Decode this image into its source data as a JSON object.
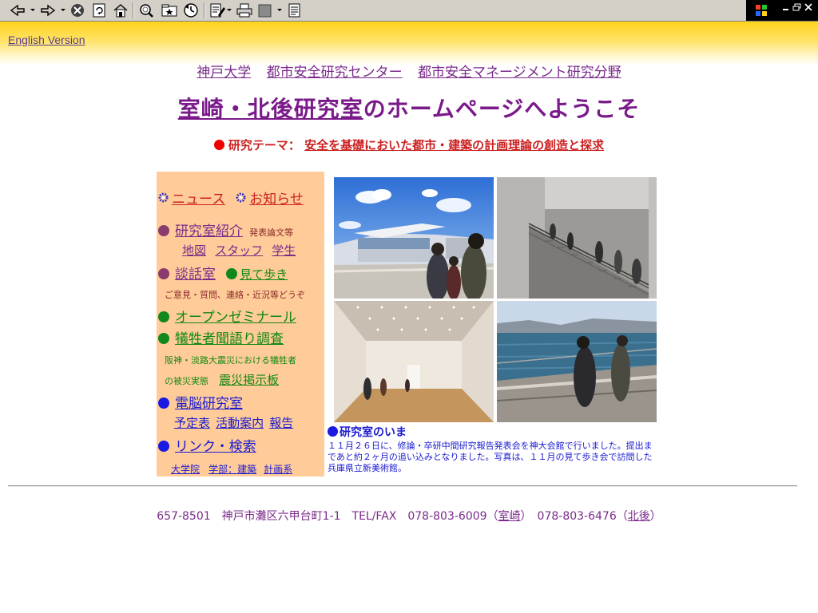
{
  "toolbar": {
    "icons": [
      "back-icon",
      "forward-icon",
      "stop-icon",
      "refresh-icon",
      "home-icon",
      "search-icon",
      "favorites-icon",
      "history-icon",
      "edit-icon",
      "print-icon",
      "media-icon",
      "notes-icon"
    ]
  },
  "english_link": "English Version",
  "breadcrumb": {
    "university": "神戸大学",
    "center": "都市安全研究センター",
    "field": "都市安全マネージメント研究分野"
  },
  "title": {
    "lab_name": "室崎・北後研究室",
    "suffix": "のホームページへようこそ"
  },
  "theme": {
    "label": "研究テーマ：",
    "text": "安全を基礎においた都市・建築の計画理論の創造と探求"
  },
  "sidebar": {
    "news": "ニュース",
    "notice": "お知らせ",
    "intro": "研究室紹介",
    "papers": "発表論文等",
    "map": "地図",
    "staff": "スタッフ",
    "students": "学生",
    "lounge": "談話室",
    "tour": "見て歩き",
    "lounge_note": "ご意見・質問、連絡・近況等どうぞ",
    "seminar": "オープンゼミナール",
    "survey": "犠牲者聞語り調査",
    "survey_note1": "阪神・淡路大震災における犠牲者",
    "survey_note2": "の被災実態",
    "board": "震災掲示板",
    "computer_lab": "電脳研究室",
    "schedule": "予定表",
    "activities": "活動案内",
    "reports": "報告",
    "links": "リンク・検索",
    "graduate": "大学院",
    "faculty": "学部：建築",
    "planning": "計画系"
  },
  "caption": {
    "title": "研究室のいま",
    "text": "１１月２６日に、修論・卒研中間研究報告発表会を神大会館で行いました。提出まであと約２ヶ月の追い込みとなりました。写真は、１１月の見て歩き会で訪問した兵庫県立新美術館。"
  },
  "footer": {
    "address": "657-8501　神戸市灘区六甲台町1-1　TEL/FAX　078-803-6009（",
    "name1": "室崎",
    "mid": "）　078-803-6476（",
    "name2": "北後",
    "end": "）"
  },
  "colors": {
    "accent_purple": "#7a1a8a",
    "link_red": "#cc2020",
    "sidebar_bg": "#ffcc99",
    "header_gradient_top": "#ffd21a",
    "caption_blue": "#1a1ad0"
  }
}
